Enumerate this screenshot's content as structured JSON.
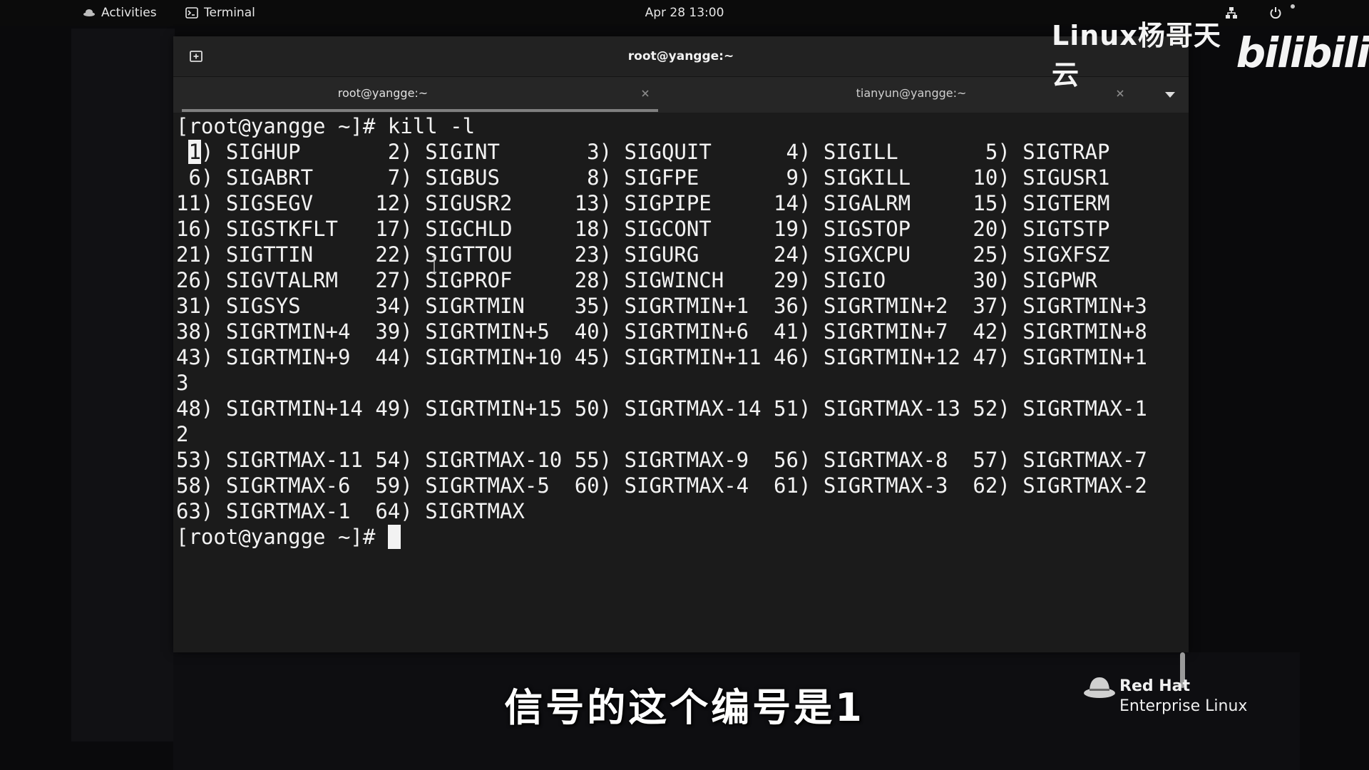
{
  "topbar": {
    "activities": "Activities",
    "app": "Terminal",
    "clock": "Apr 28  13:00",
    "icons": [
      "activities-icon",
      "terminal-app-icon",
      "network-icon",
      "power-icon"
    ]
  },
  "window": {
    "title": "root@yangge:~",
    "new_tab_icon": "new-tab-icon",
    "tabs": [
      {
        "label": "root@yangge:~",
        "active": true
      },
      {
        "label": "tianyun@yangge:~",
        "active": false
      }
    ],
    "tabs_menu_icon": "chevron-down-icon"
  },
  "terminal": {
    "command_line": "[root@yangge ~]# kill -l",
    "first_signal_number": "1",
    "output_rest": ") SIGHUP       2) SIGINT       3) SIGQUIT      4) SIGILL       5) SIGTRAP\n 6) SIGABRT      7) SIGBUS       8) SIGFPE       9) SIGKILL     10) SIGUSR1\n11) SIGSEGV     12) SIGUSR2     13) SIGPIPE     14) SIGALRM     15) SIGTERM\n16) SIGSTKFLT   17) SIGCHLD     18) SIGCONT     19) SIGSTOP     20) SIGTSTP\n21) SIGTTIN     22) SIGTTOU     23) SIGURG      24) SIGXCPU     25) SIGXFSZ\n26) SIGVTALRM   27) SIGPROF     28) SIGWINCH    29) SIGIO       30) SIGPWR\n31) SIGSYS      34) SIGRTMIN    35) SIGRTMIN+1  36) SIGRTMIN+2  37) SIGRTMIN+3\n38) SIGRTMIN+4  39) SIGRTMIN+5  40) SIGRTMIN+6  41) SIGRTMIN+7  42) SIGRTMIN+8\n43) SIGRTMIN+9  44) SIGRTMIN+10 45) SIGRTMIN+11 46) SIGRTMIN+12 47) SIGRTMIN+1\n3\n48) SIGRTMIN+14 49) SIGRTMIN+15 50) SIGRTMAX-14 51) SIGRTMAX-13 52) SIGRTMAX-1\n2\n53) SIGRTMAX-11 54) SIGRTMAX-10 55) SIGRTMAX-9  56) SIGRTMAX-8  57) SIGRTMAX-7\n58) SIGRTMAX-6  59) SIGRTMAX-5  60) SIGRTMAX-4  61) SIGRTMAX-3  62) SIGRTMAX-2\n63) SIGRTMAX-1  64) SIGRTMAX",
    "prompt": "[root@yangge ~]# "
  },
  "overlay": {
    "watermark_text": "Linux杨哥天云",
    "watermark_logo": "bilibili",
    "subtitle": "信号的这个编号是1",
    "brand_line1": "Red Hat",
    "brand_line2": "Enterprise Linux",
    "brand_icon": "redhat-logo-icon"
  },
  "colors": {
    "terminal_bg": "#1b1b1b",
    "terminal_fg": "#f2f2f2",
    "headerbar": "#222222",
    "tabbar": "#262626"
  }
}
